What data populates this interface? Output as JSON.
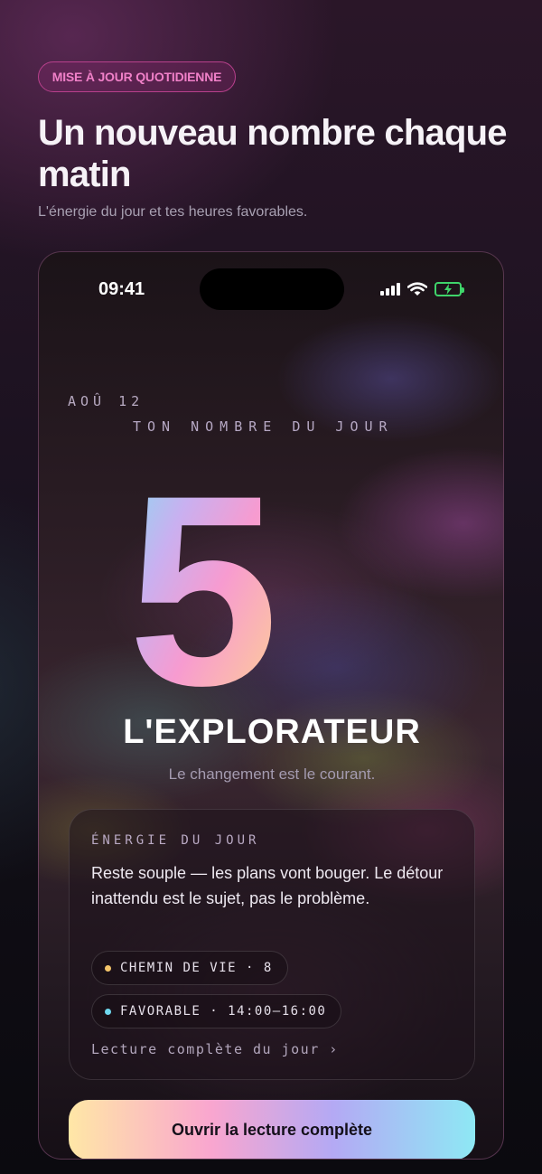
{
  "promo": {
    "badge": "MISE À JOUR QUOTIDIENNE",
    "headline": "Un nouveau nombre chaque matin",
    "subline": "L'énergie du jour et tes heures favorables."
  },
  "status_bar": {
    "time": "09:41",
    "icons": [
      "signal-icon",
      "wifi-icon",
      "battery-charging-icon"
    ]
  },
  "screen": {
    "date": "AOÛ 12",
    "label": "TON NOMBRE DU JOUR",
    "number": "5",
    "archetype": "L'EXPLORATEUR",
    "tagline": "Le changement est le courant.",
    "card": {
      "title": "ÉNERGIE DU JOUR",
      "text": "Reste souple — les plans vont bouger. Le détour inattendu est le sujet, pas le problème.",
      "chips": [
        {
          "label": "CHEMIN DE VIE · 8",
          "dot_color": "#f4c56a"
        },
        {
          "label": "FAVORABLE · 14:00–16:00",
          "dot_color": "#6fd8ee"
        }
      ],
      "link": "Lecture complète du jour ›"
    },
    "cta": "Ouvrir la lecture complète"
  },
  "colors": {
    "badge_accent": "#f080c8",
    "battery": "#3fd46a",
    "number_gradient": [
      "#7fe3f2",
      "#f79bd0",
      "#ffd98a"
    ],
    "cta_gradient": [
      "#ffe7a6",
      "#f9a6cf",
      "#b4a9f4",
      "#8ee8f4"
    ]
  }
}
